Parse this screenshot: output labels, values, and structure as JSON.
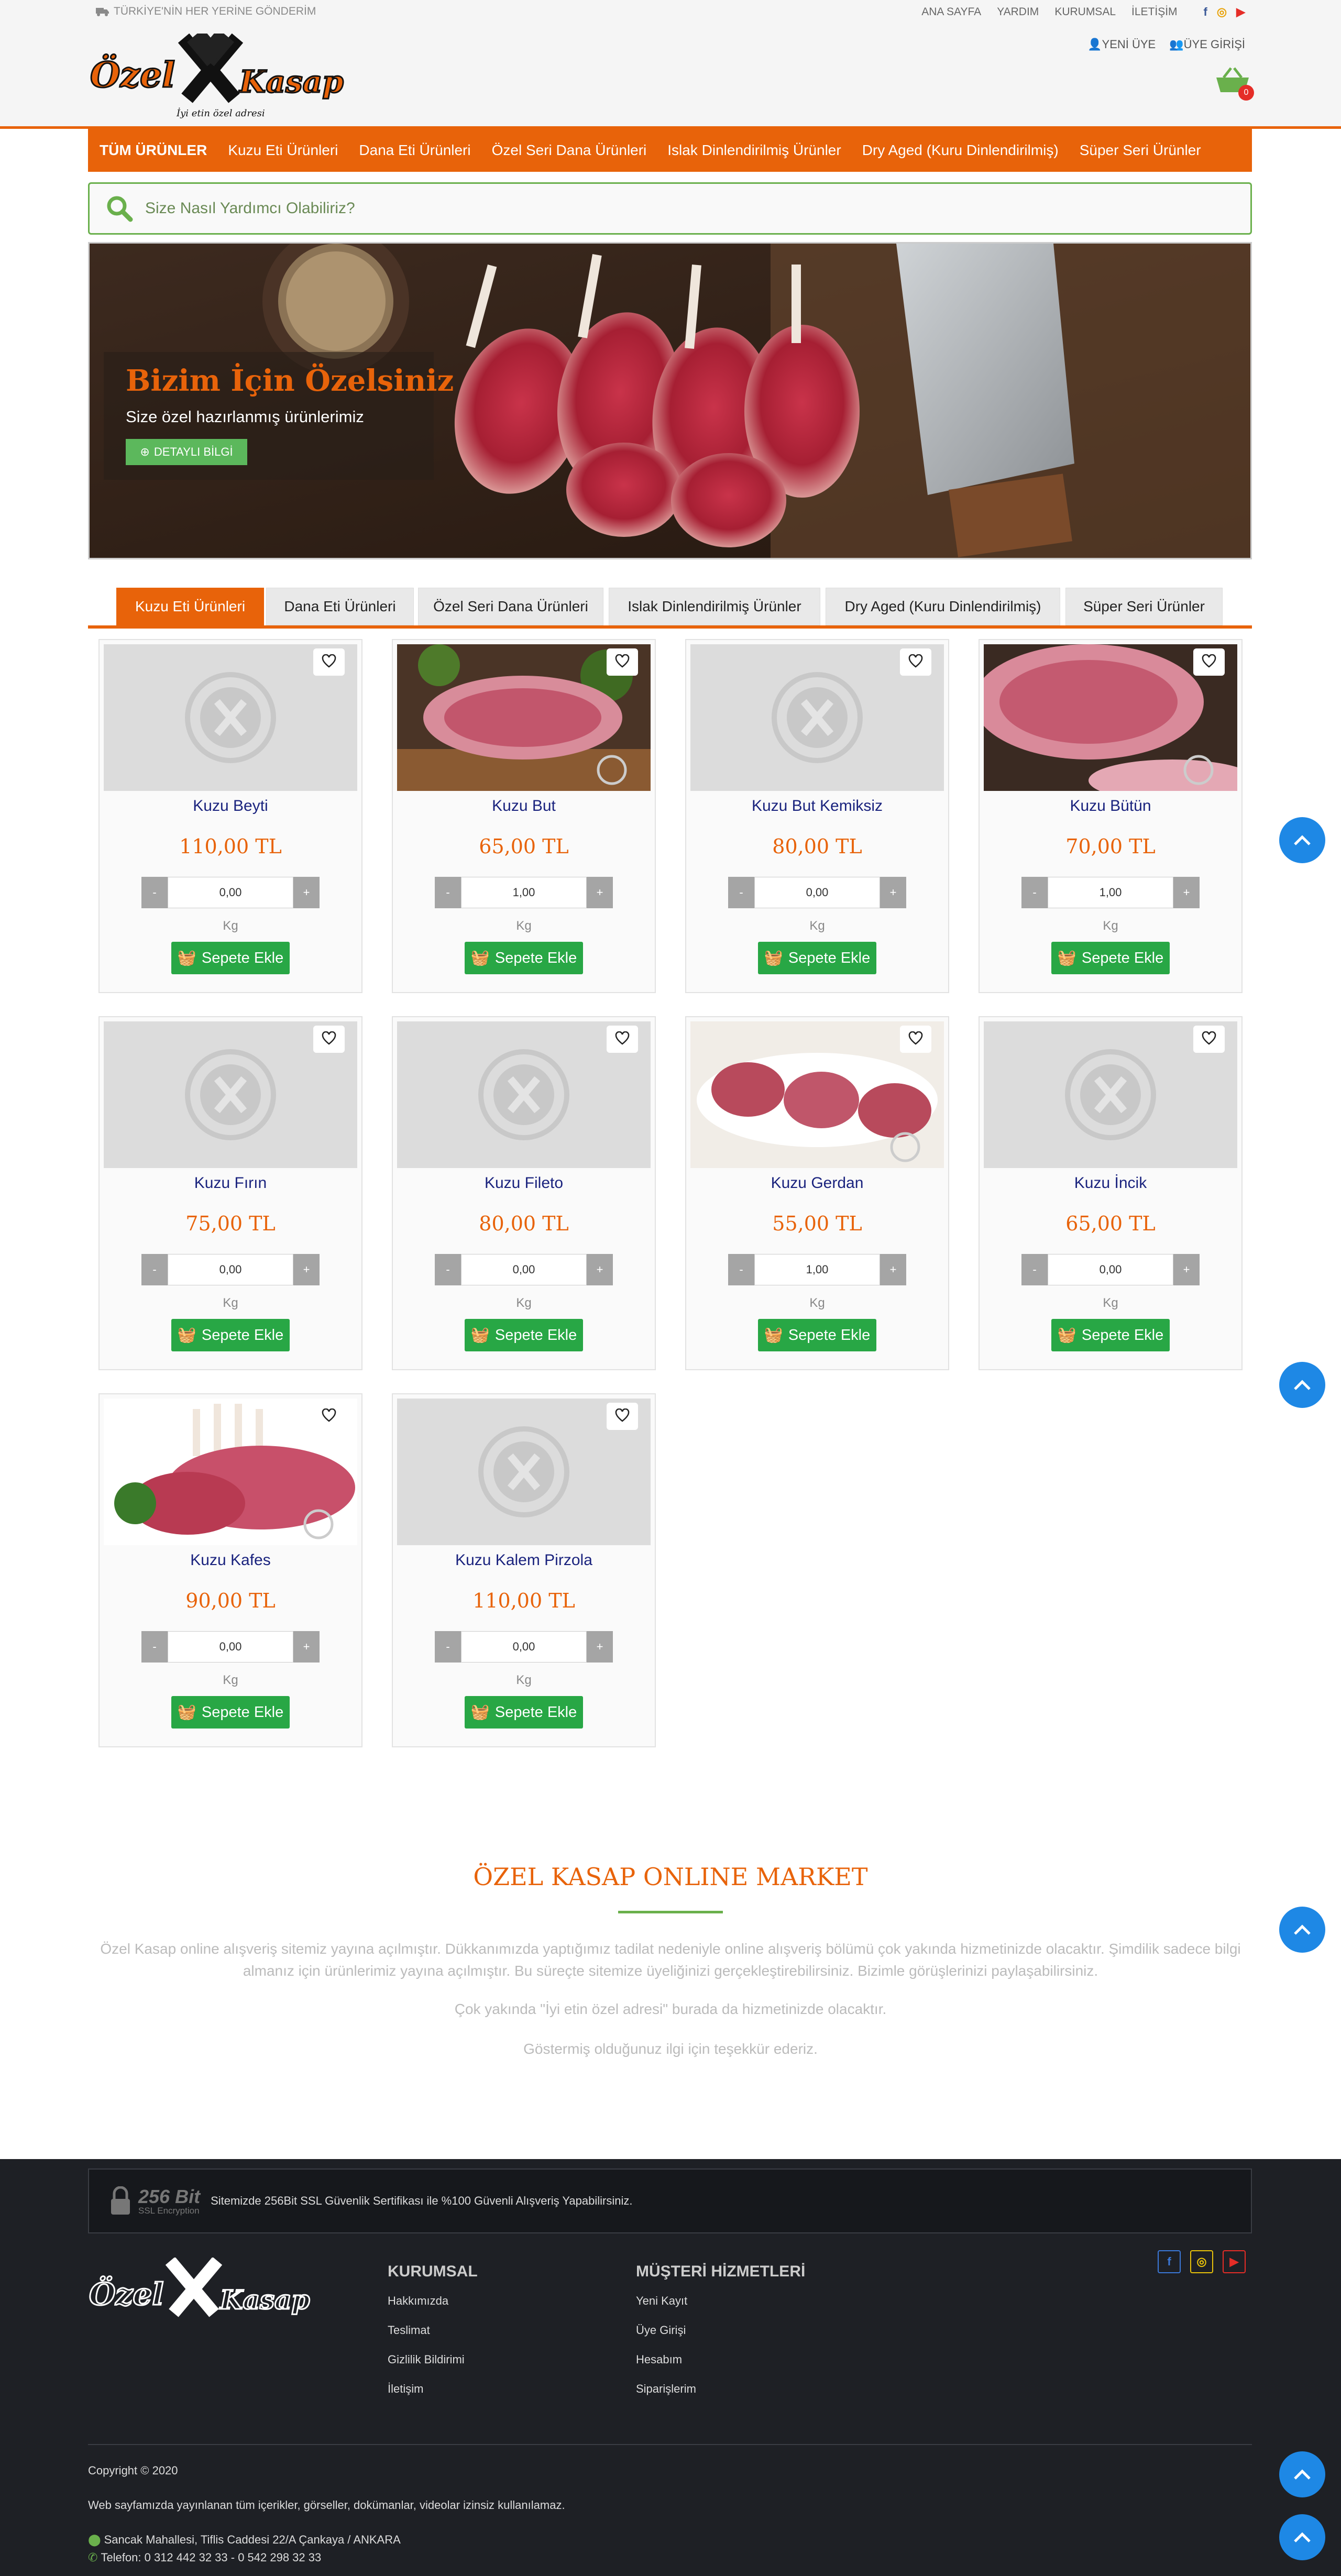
{
  "topbar": {
    "shipping": "TÜRKİYE'NİN HER YERİNE GÖNDERİM",
    "links": [
      "ANA SAYFA",
      "YARDIM",
      "KURUMSAL",
      "İLETİŞİM"
    ],
    "new_member": "YENİ ÜYE",
    "member_login": "ÜYE GİRİŞİ",
    "cart_count": "0"
  },
  "logo": {
    "brand": "Özel Kasap",
    "tagline": "İyi etin özel adresi"
  },
  "nav": [
    "TÜM ÜRÜNLER",
    "Kuzu Eti Ürünleri",
    "Dana Eti Ürünleri",
    "Özel Seri Dana Ürünleri",
    "Islak Dinlendirilmiş Ürünler",
    "Dry Aged (Kuru Dinlendirilmiş)",
    "Süper Seri Ürünler"
  ],
  "search": {
    "placeholder": "Size Nasıl Yardımcı Olabiliriz?"
  },
  "banner": {
    "title": "Bizim İçin Özelsiniz",
    "subtitle": "Size özel hazırlanmış ürünlerimiz",
    "button": "DETAYLI BİLGİ"
  },
  "tabs": [
    "Kuzu Eti Ürünleri",
    "Dana Eti Ürünleri",
    "Özel Seri Dana Ürünleri",
    "Islak Dinlendirilmiş Ürünler",
    "Dry Aged (Kuru Dinlendirilmiş)",
    "Süper Seri Ürünler"
  ],
  "products": [
    {
      "name": "Kuzu Beyti",
      "price": "110,00 TL",
      "qty": "0,00",
      "unit": "Kg",
      "image": "placeholder"
    },
    {
      "name": "Kuzu But",
      "price": "65,00 TL",
      "qty": "1,00",
      "unit": "Kg",
      "image": "photo"
    },
    {
      "name": "Kuzu But Kemiksiz",
      "price": "80,00 TL",
      "qty": "0,00",
      "unit": "Kg",
      "image": "placeholder"
    },
    {
      "name": "Kuzu Bütün",
      "price": "70,00 TL",
      "qty": "1,00",
      "unit": "Kg",
      "image": "photo"
    },
    {
      "name": "Kuzu Fırın",
      "price": "75,00 TL",
      "qty": "0,00",
      "unit": "Kg",
      "image": "placeholder"
    },
    {
      "name": "Kuzu Fileto",
      "price": "80,00 TL",
      "qty": "0,00",
      "unit": "Kg",
      "image": "placeholder"
    },
    {
      "name": "Kuzu Gerdan",
      "price": "55,00 TL",
      "qty": "1,00",
      "unit": "Kg",
      "image": "photo"
    },
    {
      "name": "Kuzu İncik",
      "price": "65,00 TL",
      "qty": "0,00",
      "unit": "Kg",
      "image": "placeholder"
    },
    {
      "name": "Kuzu Kafes",
      "price": "90,00 TL",
      "qty": "0,00",
      "unit": "Kg",
      "image": "photo"
    },
    {
      "name": "Kuzu Kalem Pirzola",
      "price": "110,00 TL",
      "qty": "0,00",
      "unit": "Kg",
      "image": "placeholder"
    }
  ],
  "buttons": {
    "minus": "-",
    "plus": "+",
    "add_to_cart": "Sepete Ekle"
  },
  "info": {
    "title": "ÖZEL KASAP ONLINE MARKET",
    "p1": "Özel Kasap online alışveriş sitemiz yayına açılmıştır. Dükkanımızda yaptığımız tadilat nedeniyle online alışveriş bölümü çok yakında hizmetinizde olacaktır. Şimdilik sadece bilgi almanız için ürünlerimiz yayına açılmıştır. Bu süreçte sitemize üyeliğinizi gerçekleştirebilirsiniz. Bizimle görüşlerinizi paylaşabilirsiniz.",
    "p2": "Çok yakında \"İyi etin özel adresi\" burada da hizmetinizde olacaktır.",
    "p3": "Göstermiş olduğunuz ilgi için teşekkür ederiz."
  },
  "footer": {
    "ssl_big": "256 Bit",
    "ssl_small": "SSL Encryption",
    "ssl_text": "Sitemizde 256Bit SSL Güvenlik Sertifikası ile %100 Güvenli Alışveriş Yapabilirsiniz.",
    "corporate_title": "KURUMSAL",
    "corporate": [
      "Hakkımızda",
      "Teslimat",
      "Gizlilik Bildirimi",
      "İletişim"
    ],
    "service_title": "MÜŞTERİ HİZMETLERİ",
    "service": [
      "Yeni Kayıt",
      "Üye Girişi",
      "Hesabım",
      "Siparişlerim"
    ],
    "copyright": "Copyright © 2020",
    "notice": "Web sayfamızda yayınlanan tüm içerikler, görseller, dokümanlar, videolar izinsiz kullanılamaz.",
    "address": "Sancak Mahallesi, Tiflis Caddesi 22/A Çankaya / ANKARA",
    "phone": "Telefon: 0 312 442 32 33 - 0 542 298 32 33"
  },
  "colors": {
    "accent": "#e8630a",
    "green": "#28a745",
    "nav_text": "#ffffff",
    "scroll_button": "#1e88e5"
  }
}
